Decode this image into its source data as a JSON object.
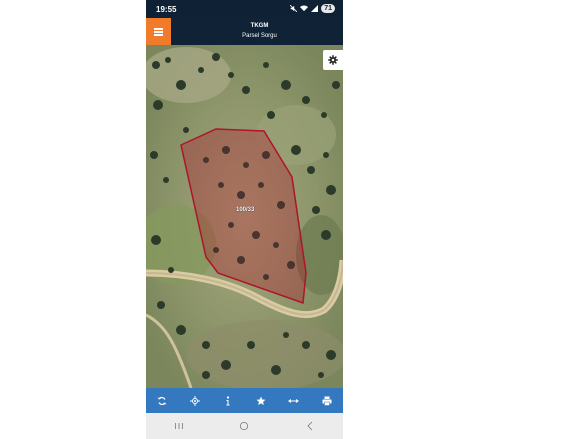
{
  "status_bar": {
    "time": "19:55",
    "battery": "71",
    "icons": [
      "mute-icon",
      "wifi-icon",
      "signal-icon",
      "battery-icon"
    ]
  },
  "header": {
    "title": "TKGM",
    "subtitle": "Parsel Sorgu",
    "menu_icon": "hamburger-icon",
    "menu_color": "#f07b2a",
    "background_color": "#0f2236"
  },
  "map": {
    "parcel_label": "100/33",
    "parcel_outline_color": "#b0132b",
    "settings_icon": "gear-icon"
  },
  "toolbar": {
    "color": "#3479c0",
    "buttons": [
      "refresh-icon",
      "locate-icon",
      "info-icon",
      "star-icon",
      "measure-icon",
      "print-icon"
    ]
  },
  "nav_bar": {
    "buttons": [
      "recent-apps-icon",
      "home-icon",
      "back-icon"
    ]
  }
}
